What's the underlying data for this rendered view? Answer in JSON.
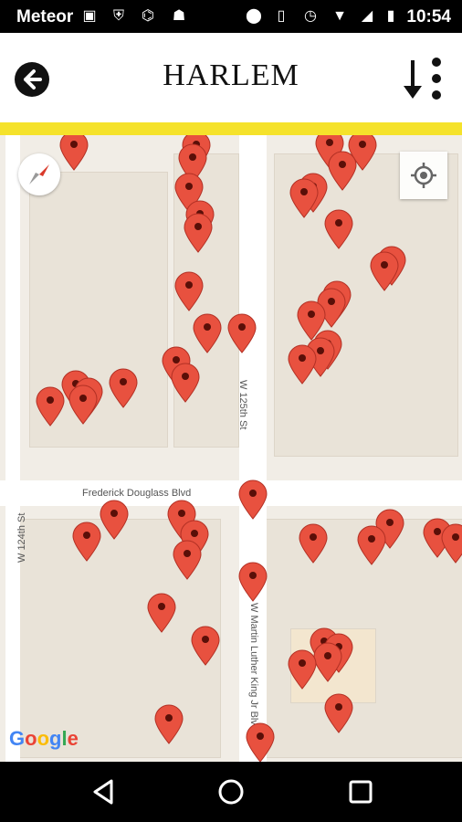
{
  "status_bar": {
    "carrier": "Meteor",
    "time": "10:54"
  },
  "header": {
    "title": "HARLEM"
  },
  "map": {
    "streets": {
      "frederick": "Frederick Douglass Blvd",
      "w125": "W 125th St",
      "w124": "W 124th St",
      "mlk": "W Martin Luther King Jr Blvd"
    },
    "attribution": "Google"
  },
  "colors": {
    "accent_bar": "#f5e22b",
    "pin": "#e8513f"
  }
}
